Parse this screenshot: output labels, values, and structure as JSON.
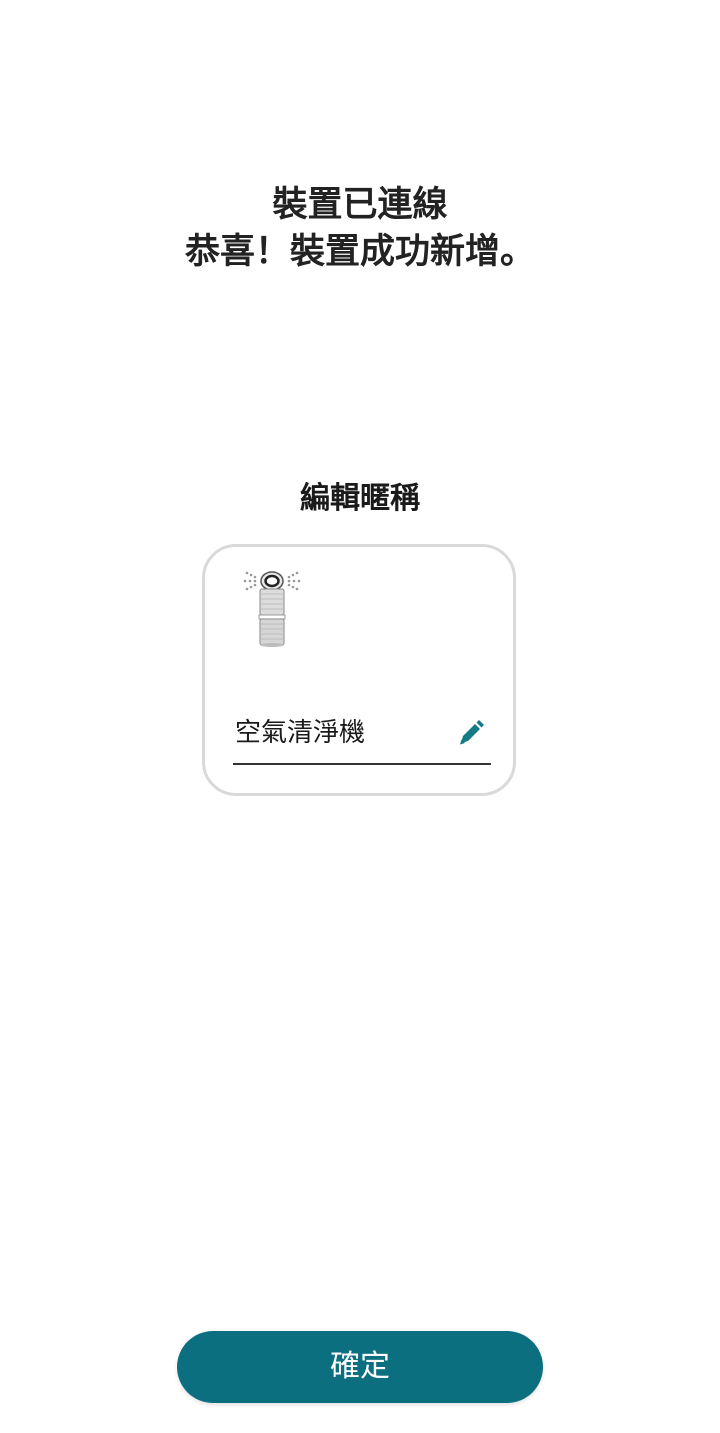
{
  "header": {
    "title": "裝置已連線",
    "subtitle": "恭喜！裝置成功新增。"
  },
  "nickname_section": {
    "label": "編輯暱稱",
    "device_name": "空氣清淨機",
    "device_image_icon": "air-purifier-icon",
    "edit_icon": "pencil-icon"
  },
  "actions": {
    "confirm_label": "確定"
  },
  "colors": {
    "accent": "#0b6f80",
    "edit_icon": "#127b85",
    "card_border": "#d9d9d9"
  }
}
